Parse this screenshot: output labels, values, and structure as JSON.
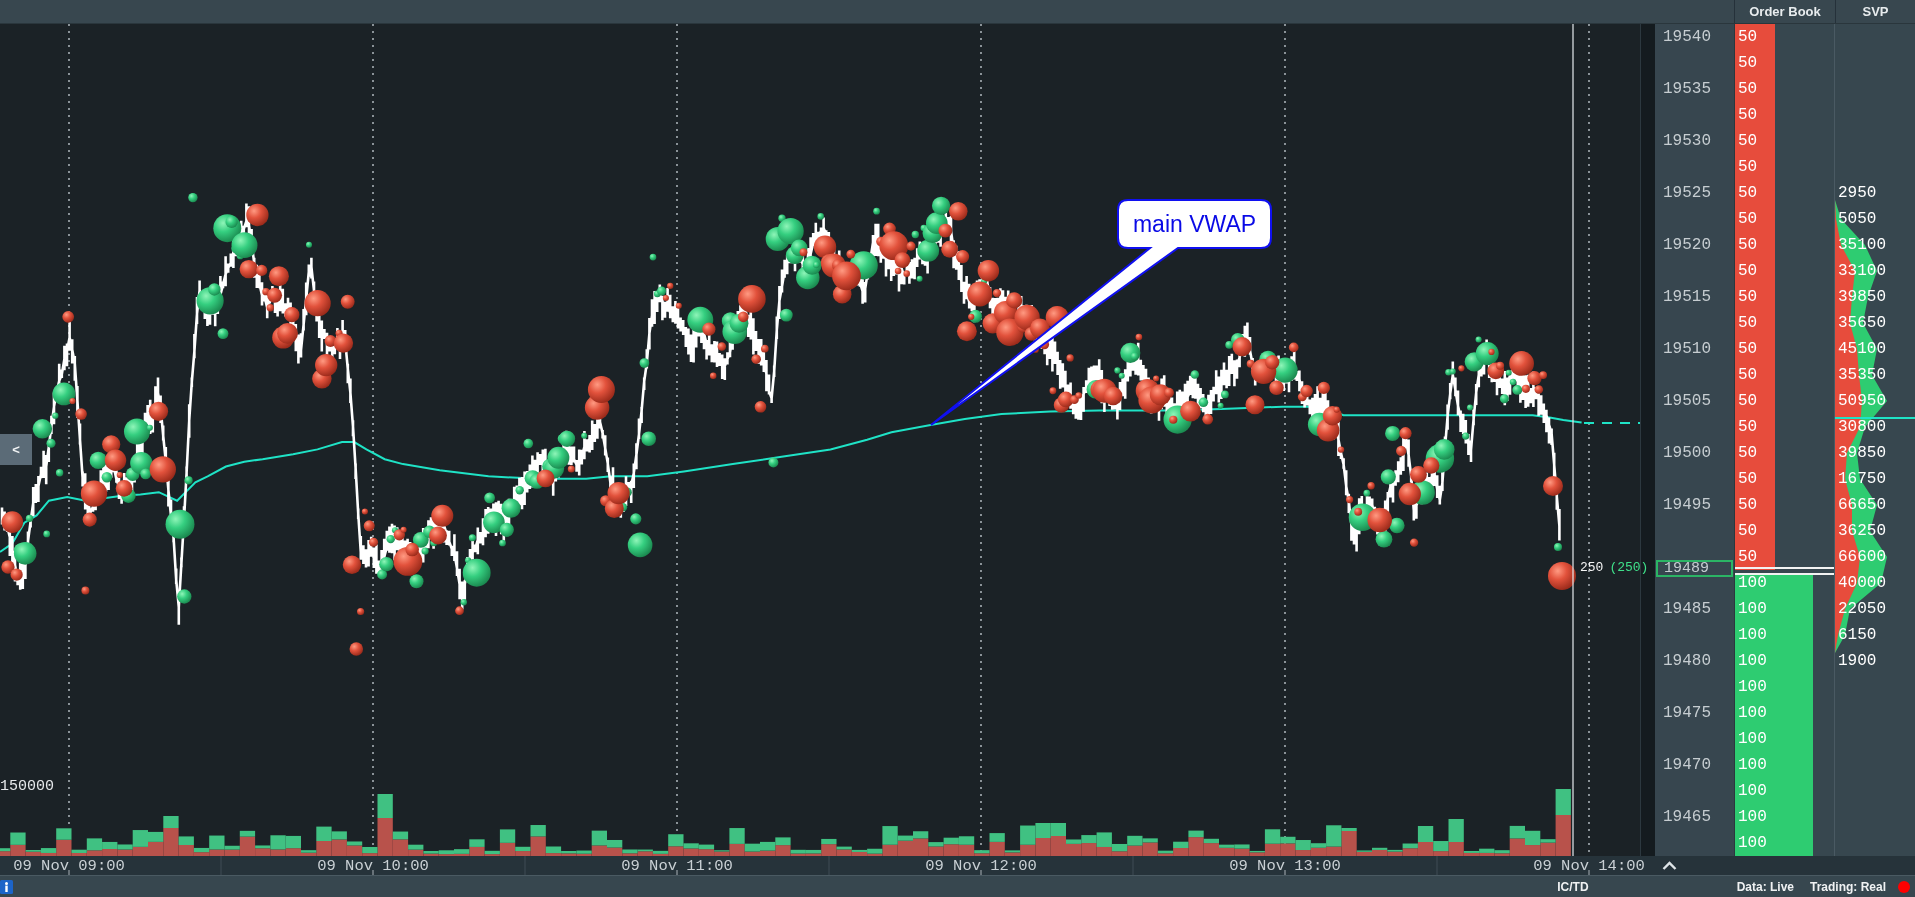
{
  "header": {
    "columns": [
      {
        "label": "Order Book"
      },
      {
        "label": "SVP"
      }
    ]
  },
  "chart": {
    "collapse_button": "<",
    "volume_scale": "150000",
    "annotation": "main VWAP",
    "last_trade": {
      "size": "250",
      "total": "(250)"
    }
  },
  "time_axis": {
    "labels": [
      "09 Nov 09:00",
      "09 Nov 10:00",
      "09 Nov 11:00",
      "09 Nov 12:00",
      "09 Nov 13:00",
      "09 Nov 14:00"
    ]
  },
  "ladder": {
    "current_price": "19489",
    "rows": [
      {
        "price": "19540",
        "order_book": {
          "size": "50",
          "kind": "ask",
          "level": 0.4
        }
      },
      {
        "order_book": {
          "size": "50",
          "kind": "ask",
          "level": 0.4
        }
      },
      {
        "price": "19535",
        "order_book": {
          "size": "50",
          "kind": "ask",
          "level": 0.4
        }
      },
      {
        "order_book": {
          "size": "50",
          "kind": "ask",
          "level": 0.4
        }
      },
      {
        "price": "19530",
        "order_book": {
          "size": "50",
          "kind": "ask",
          "level": 0.4
        }
      },
      {
        "order_book": {
          "size": "50",
          "kind": "ask",
          "level": 0.4
        }
      },
      {
        "price": "19525",
        "order_book": {
          "size": "50",
          "kind": "ask",
          "level": 0.4
        },
        "svp": "2950"
      },
      {
        "order_book": {
          "size": "50",
          "kind": "ask",
          "level": 0.4
        },
        "svp": "5050"
      },
      {
        "price": "19520",
        "order_book": {
          "size": "50",
          "kind": "ask",
          "level": 0.4
        },
        "svp": "35100"
      },
      {
        "order_book": {
          "size": "50",
          "kind": "ask",
          "level": 0.4
        },
        "svp": "33100"
      },
      {
        "price": "19515",
        "order_book": {
          "size": "50",
          "kind": "ask",
          "level": 0.4
        },
        "svp": "39850"
      },
      {
        "order_book": {
          "size": "50",
          "kind": "ask",
          "level": 0.4
        },
        "svp": "35650"
      },
      {
        "price": "19510",
        "order_book": {
          "size": "50",
          "kind": "ask",
          "level": 0.4
        },
        "svp": "45100"
      },
      {
        "order_book": {
          "size": "50",
          "kind": "ask",
          "level": 0.4
        },
        "svp": "35350"
      },
      {
        "price": "19505",
        "order_book": {
          "size": "50",
          "kind": "ask",
          "level": 0.4
        },
        "svp": "50950"
      },
      {
        "order_book": {
          "size": "50",
          "kind": "ask",
          "level": 0.4
        },
        "svp": "30800"
      },
      {
        "price": "19500",
        "order_book": {
          "size": "50",
          "kind": "ask",
          "level": 0.4
        },
        "svp": "39850"
      },
      {
        "order_book": {
          "size": "50",
          "kind": "ask",
          "level": 0.4
        },
        "svp": "16750"
      },
      {
        "price": "19495",
        "order_book": {
          "size": "50",
          "kind": "ask",
          "level": 0.4
        },
        "svp": "66650"
      },
      {
        "order_book": {
          "size": "50",
          "kind": "ask",
          "level": 0.4
        },
        "svp": "36250"
      },
      {
        "order_book": {
          "size": "50",
          "kind": "ask",
          "level": 0.4
        },
        "svp": "66600"
      },
      {
        "order_book": {
          "size": "100",
          "kind": "bid",
          "level": 0.79
        },
        "svp": "40000"
      },
      {
        "price": "19485",
        "order_book": {
          "size": "100",
          "kind": "bid",
          "level": 0.79
        },
        "svp": "22050"
      },
      {
        "order_book": {
          "size": "100",
          "kind": "bid",
          "level": 0.79
        },
        "svp": "6150"
      },
      {
        "price": "19480",
        "order_book": {
          "size": "100",
          "kind": "bid",
          "level": 0.79
        },
        "svp": "1900"
      },
      {
        "order_book": {
          "size": "100",
          "kind": "bid",
          "level": 0.79
        }
      },
      {
        "price": "19475",
        "order_book": {
          "size": "100",
          "kind": "bid",
          "level": 0.79
        }
      },
      {
        "order_book": {
          "size": "100",
          "kind": "bid",
          "level": 0.79
        }
      },
      {
        "price": "19470",
        "order_book": {
          "size": "100",
          "kind": "bid",
          "level": 0.79
        }
      },
      {
        "order_book": {
          "size": "100",
          "kind": "bid",
          "level": 0.79
        }
      },
      {
        "price": "19465",
        "order_book": {
          "size": "100",
          "kind": "bid",
          "level": 0.79
        }
      },
      {
        "order_book": {
          "size": "100",
          "kind": "bid",
          "level": 0.79
        }
      }
    ]
  },
  "status_bar": {
    "mode": "IC/TD",
    "data": "Data: Live",
    "trading": "Trading: Real"
  }
}
